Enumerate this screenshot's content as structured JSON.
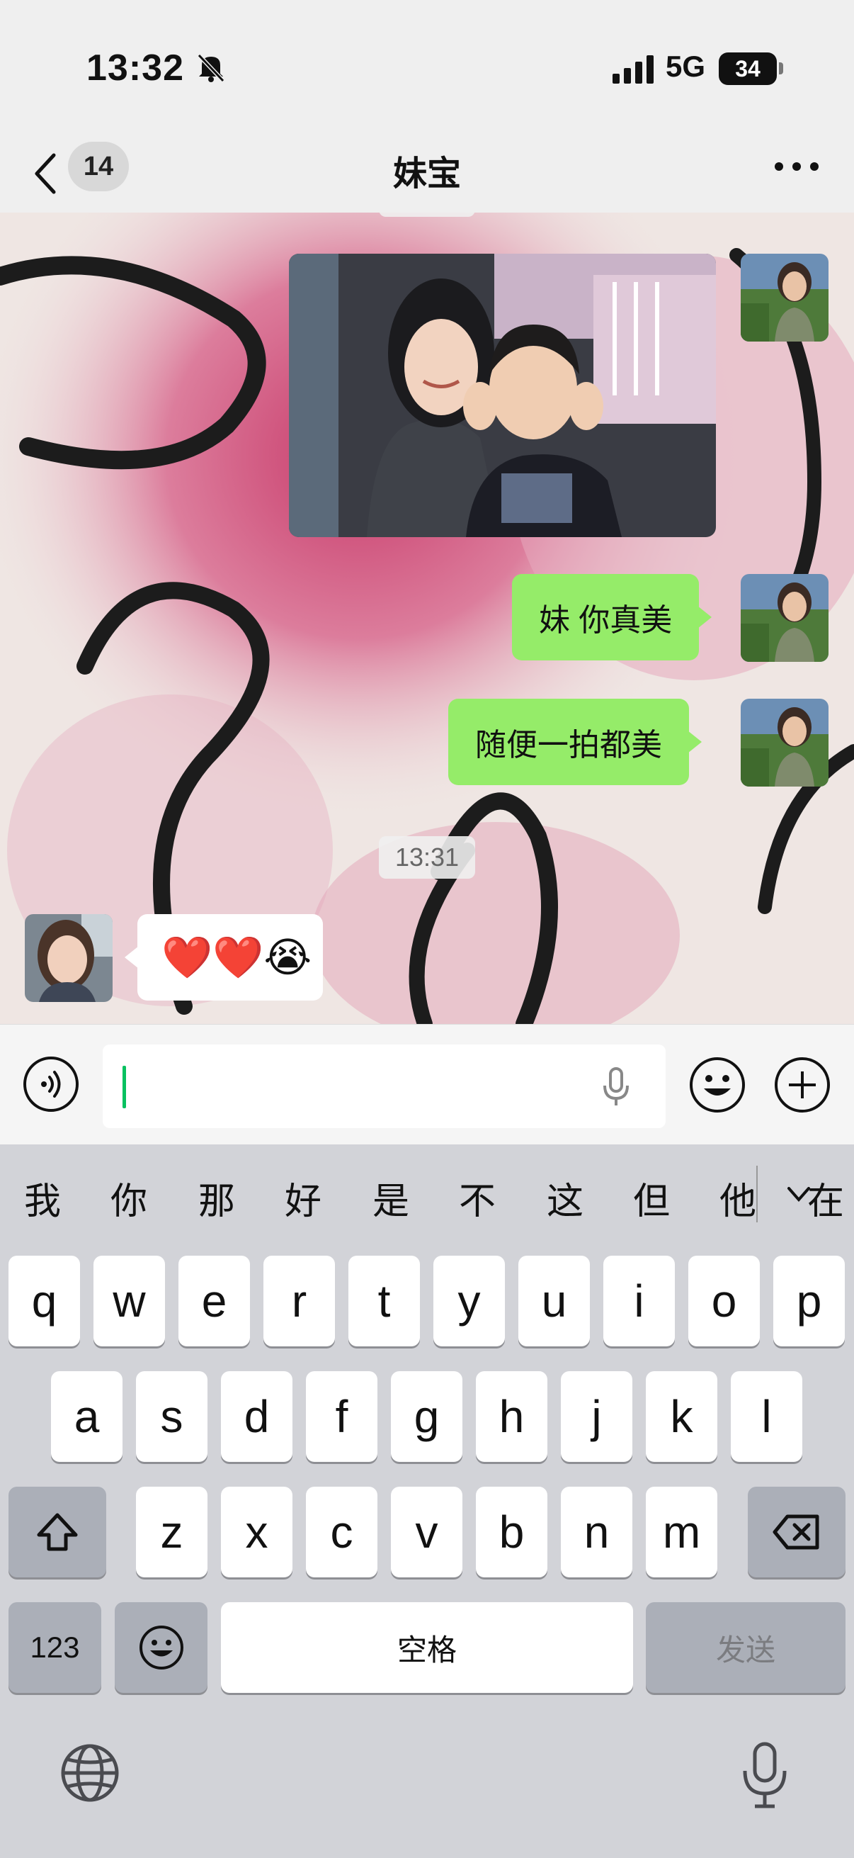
{
  "status_bar": {
    "time": "13:32",
    "network": "5G",
    "battery": "34",
    "silent_icon": "bell-slash-icon",
    "signal_icon": "signal-bars-icon"
  },
  "nav": {
    "back_icon": "chevron-left-icon",
    "unread_count": "14",
    "title": "妹宝",
    "more_icon": "ellipsis-icon"
  },
  "chat": {
    "messages": [
      {
        "from": "me",
        "type": "image",
        "image": "photo-woman-and-boy"
      },
      {
        "from": "me",
        "type": "text",
        "text": "妹 你真美"
      },
      {
        "from": "me",
        "type": "text",
        "text": "随便一拍都美"
      },
      {
        "type": "timestamp",
        "text": "13:31"
      },
      {
        "from": "other",
        "type": "emoji",
        "text": "❤️❤️😭"
      }
    ],
    "colors": {
      "my_bubble": "#95ec69",
      "other_bubble": "#ffffff"
    }
  },
  "input": {
    "value": "",
    "voice_icon": "voice-wave-icon",
    "mic_icon": "microphone-icon",
    "emoji_icon": "smiley-icon",
    "plus_icon": "plus-circle-icon"
  },
  "keyboard": {
    "candidates": [
      "我",
      "你",
      "那",
      "好",
      "是",
      "不",
      "这",
      "但",
      "他",
      "在"
    ],
    "row1": [
      "q",
      "w",
      "e",
      "r",
      "t",
      "y",
      "u",
      "i",
      "o",
      "p"
    ],
    "row2": [
      "a",
      "s",
      "d",
      "f",
      "g",
      "h",
      "j",
      "k",
      "l"
    ],
    "row3": [
      "z",
      "x",
      "c",
      "v",
      "b",
      "n",
      "m"
    ],
    "numbers_key": "123",
    "space_key": "空格",
    "send_key": "发送",
    "shift_icon": "shift-icon",
    "delete_icon": "backspace-icon",
    "emoji_icon": "emoji-icon",
    "globe_icon": "globe-icon",
    "dictation_icon": "microphone-icon"
  }
}
